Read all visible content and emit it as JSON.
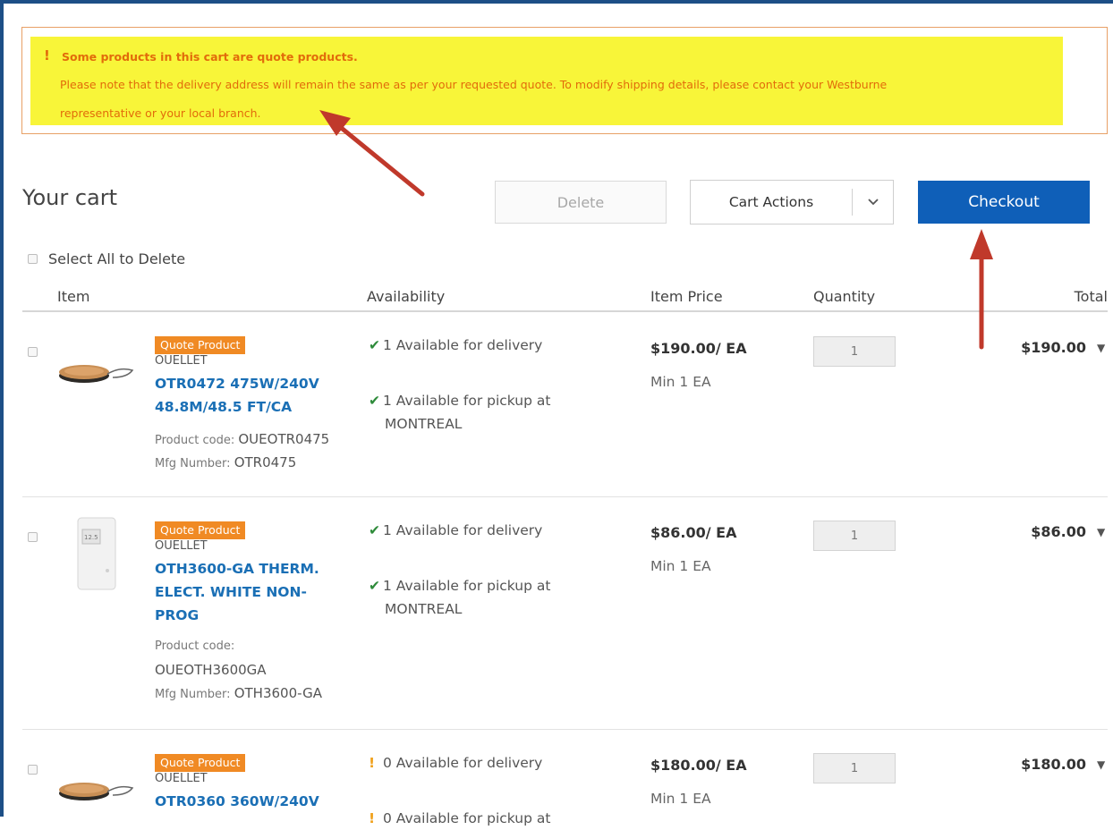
{
  "notice": {
    "title": "Some products in this cart are quote products.",
    "line1": "Please note that the delivery address will remain the same as per your requested quote. To modify shipping details, please contact your Westburne",
    "line2": "representative or your local branch."
  },
  "toolbar": {
    "title": "Your cart",
    "delete_label": "Delete",
    "cart_actions_label": "Cart Actions",
    "checkout_label": "Checkout"
  },
  "select_all_label": "Select All to Delete",
  "columns": {
    "item": "Item",
    "availability": "Availability",
    "price": "Item Price",
    "quantity": "Quantity",
    "total": "Total"
  },
  "items": [
    {
      "badge": "Quote Product",
      "brand": "OUELLET",
      "name": "OTR0472 475W/240V 48.8M/48.5 FT/CA",
      "product_code_label": "Product code:",
      "product_code": "OUEOTR0475",
      "mfg_label": "Mfg Number:",
      "mfg_number": "OTR0475",
      "delivery": "1  Available for delivery",
      "pickup": "1  Available for pickup at",
      "pickup_location": "MONTREAL",
      "price": "$190.00/ EA",
      "min": "Min  1 EA",
      "qty": "1",
      "total": "$190.00"
    },
    {
      "badge": "Quote Product",
      "brand": "OUELLET",
      "name": "OTH3600-GA THERM. ELECT. WHITE NON-PROG",
      "product_code_label": "Product code:",
      "product_code": "OUEOTH3600GA",
      "mfg_label": "Mfg Number:",
      "mfg_number": "OTH3600-GA",
      "delivery": "1  Available for delivery",
      "pickup": "1  Available for pickup at",
      "pickup_location": "MONTREAL",
      "price": "$86.00/ EA",
      "min": "Min  1 EA",
      "qty": "1",
      "total": "$86.00"
    },
    {
      "badge": "Quote Product",
      "brand": "OUELLET",
      "name": "OTR0360 360W/240V",
      "delivery": "0  Available for delivery",
      "pickup": "0  Available for pickup at",
      "price": "$180.00/ EA",
      "min": "Min  1 EA",
      "qty": "1",
      "total": "$180.00"
    }
  ],
  "icons": {
    "check": "check-icon",
    "warning": "exclamation-icon",
    "dropdown": "chevron-down-icon",
    "expand": "triangle-down-icon"
  },
  "colors": {
    "notice_bg": "#f8f539",
    "notice_text": "#e26b0a",
    "badge": "#f08a24",
    "link": "#1a6fb5",
    "checkout": "#0f5fb8",
    "annotation_arrow": "#c0392b"
  }
}
